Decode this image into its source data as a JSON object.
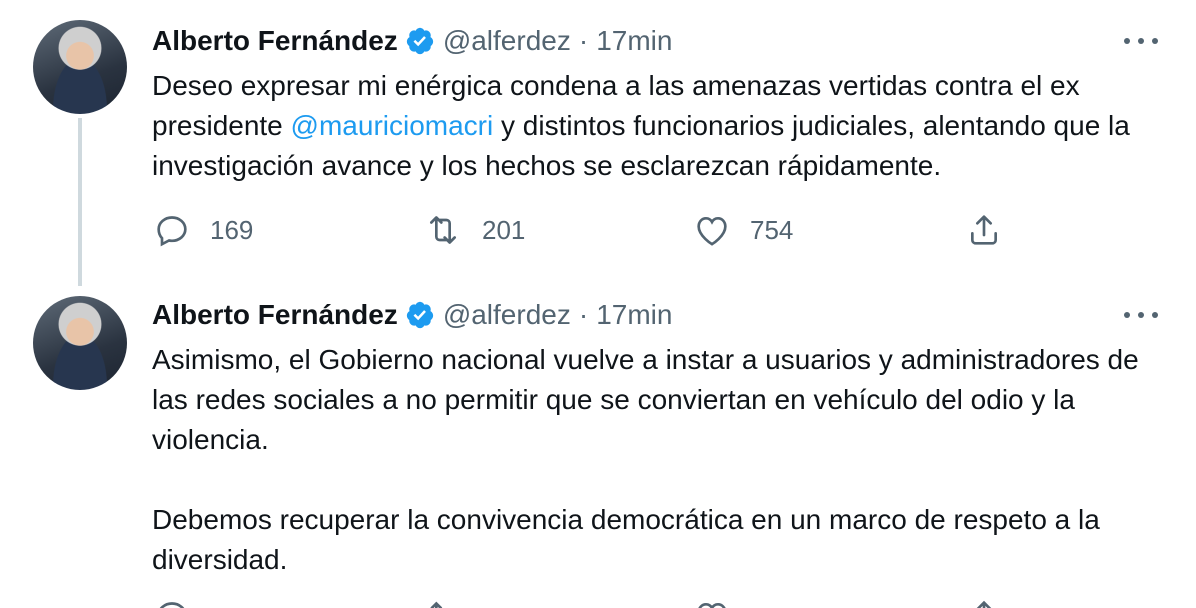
{
  "tweets": [
    {
      "name": "Alberto Fernández",
      "handle": "@alferdez",
      "separator": "·",
      "time": "17min",
      "text_before": "Deseo expresar mi enérgica condena a las amenazas vertidas contra el ex presidente ",
      "mention": "@mauriciomacri",
      "text_after": " y distintos funcionarios judiciales, alentando que la investigación avance y los hechos se esclarezcan rápidamente.",
      "replies": "169",
      "retweets": "201",
      "likes": "754"
    },
    {
      "name": "Alberto Fernández",
      "handle": "@alferdez",
      "separator": "·",
      "time": "17min",
      "paragraph1": "Asimismo, el Gobierno nacional vuelve a instar a usuarios y administradores de las redes sociales a no permitir que se conviertan en vehículo del odio y la violencia.",
      "paragraph2": "Debemos recuperar la convivencia democrática en un marco de respeto a la diversidad."
    }
  ],
  "icons": {
    "verified": "verified-badge-icon",
    "more": "more-icon",
    "reply": "reply-icon",
    "retweet": "retweet-icon",
    "like": "like-icon",
    "share": "share-icon"
  },
  "colors": {
    "link": "#1d9bf0",
    "secondary_text": "#536471",
    "verified": "#1d9bf0",
    "thread_line": "#cfd9de"
  }
}
